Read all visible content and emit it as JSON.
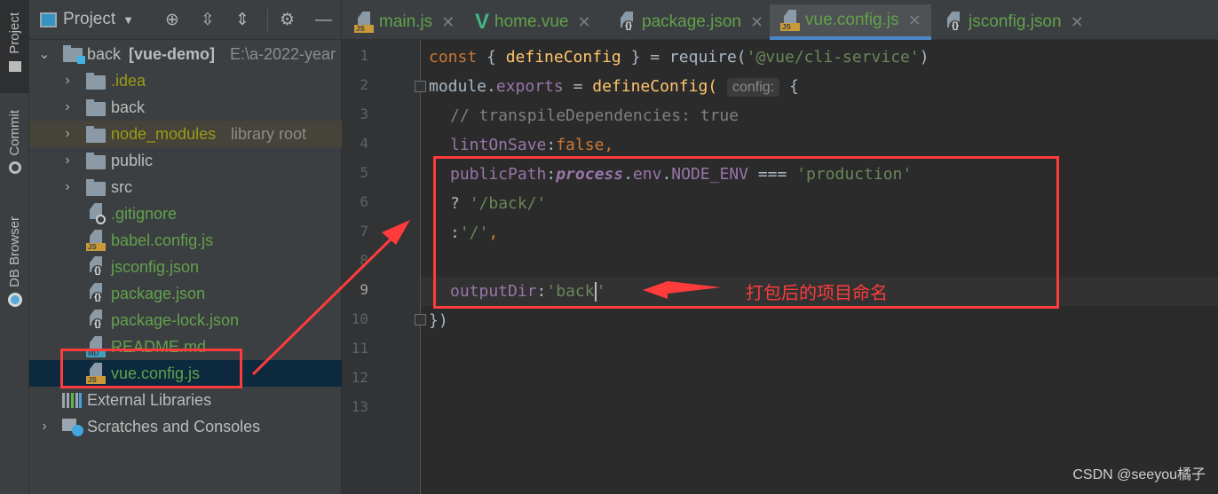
{
  "left_stripe": {
    "tabs": [
      {
        "label": "Project",
        "icon": "folder-icon",
        "active": true
      },
      {
        "label": "Commit",
        "icon": "commit-icon",
        "active": false
      },
      {
        "label": "DB Browser",
        "icon": "db-browser-icon",
        "active": false
      }
    ]
  },
  "project_panel": {
    "title": "Project",
    "toolbar_icons": [
      "locate-icon",
      "expand-all-icon",
      "collapse-all-icon",
      "gear-icon",
      "minimize-icon"
    ],
    "root": {
      "name": "back",
      "module": "[vue-demo]",
      "path": "E:\\a-2022-year"
    },
    "tree": [
      {
        "label": ".idea",
        "type": "folder",
        "color": "olive",
        "expandable": true
      },
      {
        "label": "back",
        "type": "folder",
        "color": "default",
        "expandable": true
      },
      {
        "label": "node_modules",
        "suffix": "library root",
        "type": "folder",
        "color": "olive",
        "expandable": true
      },
      {
        "label": "public",
        "type": "folder",
        "color": "default",
        "expandable": true
      },
      {
        "label": "src",
        "type": "folder",
        "color": "default",
        "expandable": true
      },
      {
        "label": ".gitignore",
        "type": "ignore",
        "color": "green"
      },
      {
        "label": "babel.config.js",
        "type": "js",
        "color": "green"
      },
      {
        "label": "jsconfig.json",
        "type": "json",
        "color": "green"
      },
      {
        "label": "package.json",
        "type": "json",
        "color": "green"
      },
      {
        "label": "package-lock.json",
        "type": "json",
        "color": "green"
      },
      {
        "label": "README.md",
        "type": "md",
        "color": "green"
      },
      {
        "label": "vue.config.js",
        "type": "js",
        "color": "green",
        "selected": true
      }
    ],
    "external_libraries": "External Libraries",
    "scratches": "Scratches and Consoles"
  },
  "editor_tabs": [
    {
      "label": "main.js",
      "icon": "js-file-icon",
      "active": false
    },
    {
      "label": "home.vue",
      "icon": "vue-file-icon",
      "active": false
    },
    {
      "label": "package.json",
      "icon": "json-file-icon",
      "active": false
    },
    {
      "label": "vue.config.js",
      "icon": "js-file-icon",
      "active": true
    },
    {
      "label": "jsconfig.json",
      "icon": "json-file-icon",
      "active": false
    }
  ],
  "editor": {
    "line_numbers": [
      "1",
      "2",
      "3",
      "4",
      "5",
      "6",
      "7",
      "8",
      "9",
      "10",
      "11",
      "12",
      "13"
    ],
    "current_line": 9,
    "code": {
      "l1": {
        "kw": "const",
        "p1": " { ",
        "fn": "defineConfig",
        "p2": " } = require(",
        "str": "'@vue/cli-service'",
        "p3": ")"
      },
      "l2": {
        "mod": "module",
        "dot": ".",
        "prop": "exports",
        "p1": " = ",
        "fn": "defineConfig",
        "p2": "( ",
        "hint": "config:",
        "p3": " {"
      },
      "l3": {
        "cmt": "// transpileDependencies: true"
      },
      "l4": {
        "prop": "lintOnSave",
        "p1": ":",
        "kw": "false,"
      },
      "l5": {
        "prop": "publicPath",
        "p1": ":",
        "ital": "process",
        "p2": ".",
        "prop2": "env",
        "p3": ".",
        "prop3": "NODE_ENV",
        "p4": " === ",
        "str": "'production'"
      },
      "l6": {
        "p1": "? ",
        "str": "'/back/'"
      },
      "l7": {
        "p1": ":",
        "str": "'/'",
        "kw": ","
      },
      "l9": {
        "prop": "outputDir",
        "p1": ":",
        "str1": "'back",
        "str2": "'"
      },
      "l10": {
        "p1": "})"
      }
    }
  },
  "annotations": {
    "label": "打包后的项目命名",
    "color": "#ff3b3b"
  },
  "watermark": "CSDN @seeyou橘子"
}
